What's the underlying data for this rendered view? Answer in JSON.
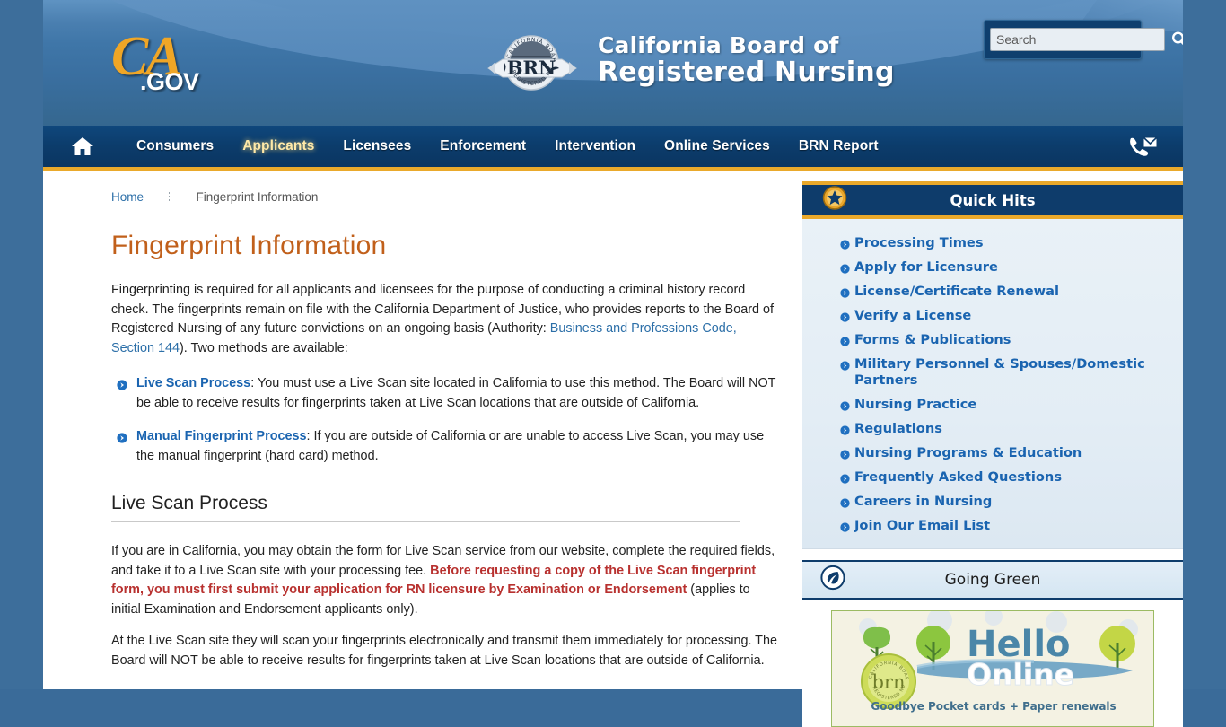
{
  "header": {
    "state_logo": {
      "ca": "CA",
      "gov": ".GOV"
    },
    "seal": {
      "top_text": "CALIFORNIA BOARD OF",
      "center_text": "BRN",
      "bottom_text": "REGISTERED NURSING"
    },
    "site_title_line1": "California Board of",
    "site_title_line2": "Registered Nursing",
    "search": {
      "placeholder": "Search",
      "value": "",
      "button_label": "Search"
    }
  },
  "nav": {
    "home_label": "Home",
    "items": [
      {
        "label": "Consumers",
        "active": false
      },
      {
        "label": "Applicants",
        "active": true
      },
      {
        "label": "Licensees",
        "active": false
      },
      {
        "label": "Enforcement",
        "active": false
      },
      {
        "label": "Intervention",
        "active": false
      },
      {
        "label": "Online Services",
        "active": false
      },
      {
        "label": "BRN Report",
        "active": false
      }
    ],
    "contact_label": "Contact Us"
  },
  "breadcrumb": {
    "home": "Home",
    "current": "Fingerprint Information"
  },
  "main": {
    "page_title": "Fingerprint Information",
    "intro_part1": "Fingerprinting is required for all applicants and licensees for the purpose of conducting a criminal history record check. The fingerprints remain on file with the California Department of Justice, who provides reports to the Board of Registered Nursing of any future convictions on an ongoing basis (Authority: ",
    "intro_link": "Business and Professions Code, Section 144",
    "intro_part2": "). Two methods are available:",
    "methods": [
      {
        "label": "Live Scan Process",
        "text": ": You must use a Live Scan site located in California to use this method. The Board will NOT be able to receive results for fingerprints taken at Live Scan locations that are outside of California."
      },
      {
        "label": "Manual Fingerprint Process",
        "text": ": If you are outside of California or are unable to access Live Scan, you may use the manual fingerprint (hard card) method."
      }
    ],
    "section_heading": "Live Scan Process",
    "para2_part1": "If you are in California, you may obtain the form for Live Scan service from our website, complete the required fields, and take it to a Live Scan site with your processing fee. ",
    "para2_red": "Before requesting a copy of the Live Scan fingerprint form, you must first submit your application for RN licensure by Examination or Endorsement",
    "para2_part2": " (applies to initial Examination and Endorsement applicants only).",
    "para3": "At the Live Scan site they will scan your fingerprints electronically and transmit them immediately for processing. The Board will NOT be able to receive results for fingerprints taken at Live Scan locations that are outside of California."
  },
  "sidebar": {
    "quick_hits": {
      "title": "Quick Hits",
      "icon": "star-badge-icon",
      "links": [
        "Processing Times",
        "Apply for Licensure",
        "License/Certificate Renewal",
        "Verify a License",
        "Forms & Publications",
        "Military Personnel & Spouses/Domestic Partners",
        "Nursing Practice",
        "Regulations",
        "Nursing Programs & Education",
        "Frequently Asked Questions",
        "Careers in Nursing",
        "Join Our Email List"
      ]
    },
    "going_green": {
      "title": "Going Green",
      "icon": "leaf-circle-icon",
      "banner": {
        "hello": "Hello",
        "online": "Online",
        "tagline": "Goodbye Pocket cards + Paper renewals",
        "seal_text": "brn"
      }
    }
  },
  "colors": {
    "header_blue": "#3f76a8",
    "nav_navy": "#0c3c6b",
    "gold": "#eaa92b",
    "title_orange": "#c1601b",
    "link_blue": "#1a64b0",
    "red_emphasis": "#b8312f",
    "page_bg": "#3d6e9b"
  }
}
